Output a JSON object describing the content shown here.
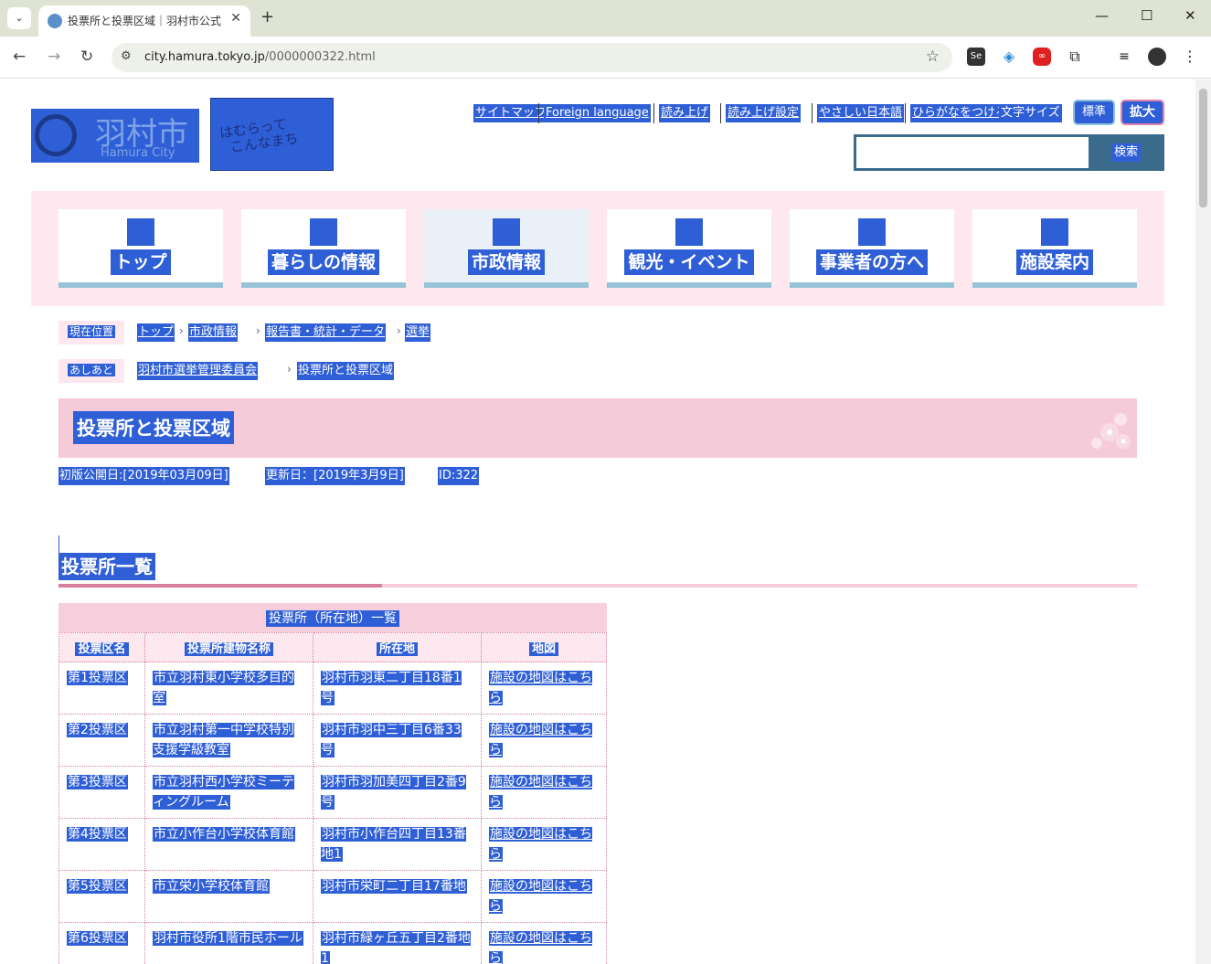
{
  "browser": {
    "tab_title": "投票所と投票区域｜羽村市公式",
    "url_host": "city.hamura.tokyo.jp",
    "url_path": "/0000000322.html"
  },
  "header": {
    "logo_jp": "羽村市",
    "logo_en": "Hamura City",
    "banner_text_1": "はむらって",
    "banner_text_2": "こんなまち",
    "links": [
      "サイトマップ",
      "Foreign language",
      "読み上げ",
      "読み上げ設定",
      "やさしい日本語",
      "ひらがなをつける"
    ],
    "font_size_label": "文字サイズ",
    "font_standard": "標準",
    "font_large": "拡大",
    "search_button": "検索"
  },
  "gnav": [
    "トップ",
    "暮らしの情報",
    "市政情報",
    "観光・イベント",
    "事業者の方へ",
    "施設案内"
  ],
  "breadcrumb": {
    "current_label": "現在位置",
    "items": [
      "トップ",
      "市政情報",
      "報告書・統計・データ",
      "選挙"
    ],
    "history_label": "あしあと",
    "history": [
      "羽村市選挙管理委員会",
      "投票所と投票区域"
    ]
  },
  "page": {
    "title": "投票所と投票区域",
    "published": "初版公開日:[2019年03月09日]",
    "updated": "更新日：[2019年3月9日]",
    "id": "ID:322",
    "section_title": "投票所一覧"
  },
  "table": {
    "caption": "投票所（所在地）一覧",
    "headers": [
      "投票区名",
      "投票所建物名称",
      "所在地",
      "地図"
    ],
    "rows": [
      [
        "第1投票区",
        "市立羽村東小学校多目的室",
        "羽村市羽東二丁目18番1号",
        "施設の地図はこちら"
      ],
      [
        "第2投票区",
        "市立羽村第一中学校特別支援学級教室",
        "羽村市羽中三丁目6番33号",
        "施設の地図はこちら"
      ],
      [
        "第3投票区",
        "市立羽村西小学校ミーティングルーム",
        "羽村市羽加美四丁目2番9号",
        "施設の地図はこちら"
      ],
      [
        "第4投票区",
        "市立小作台小学校体育館",
        "羽村市小作台四丁目13番地1",
        "施設の地図はこちら"
      ],
      [
        "第5投票区",
        "市立栄小学校体育館",
        "羽村市栄町二丁目17番地",
        "施設の地図はこちら"
      ],
      [
        "第6投票区",
        "羽村市役所1階市民ホール",
        "羽村市緑ヶ丘五丁目2番地1",
        "施設の地図はこちら"
      ]
    ]
  }
}
